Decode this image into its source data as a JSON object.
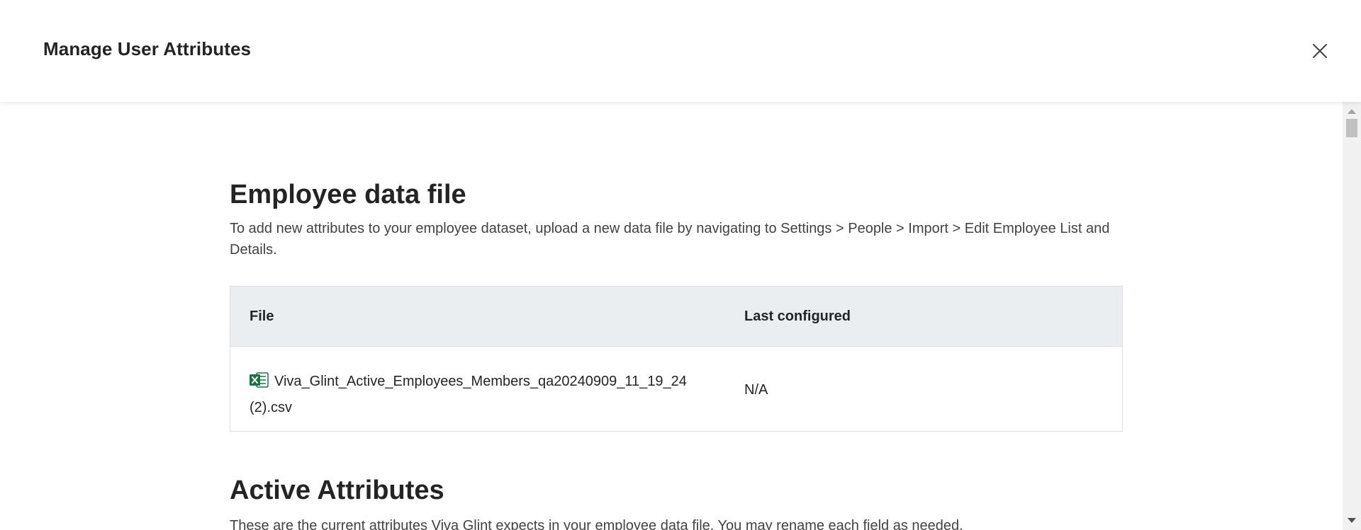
{
  "dialog": {
    "title": "Manage User Attributes",
    "close_icon": "close-icon"
  },
  "employee_data": {
    "heading": "Employee data file",
    "description": "To add new attributes to your employee dataset, upload a new data file by navigating to Settings > People > Import > Edit Employee List and Details.",
    "table": {
      "columns": [
        "File",
        "Last configured"
      ],
      "rows": [
        {
          "file_icon": "excel-file-icon",
          "file_name": "Viva_Glint_Active_Employees_Members_qa20240909_11_19_24 (2).csv",
          "last_configured": "N/A"
        }
      ]
    }
  },
  "active_attributes": {
    "heading": "Active Attributes",
    "description": "These are the current attributes Viva Glint expects in your employee data file. You may rename each field as needed."
  },
  "colors": {
    "table_header_bg": "#ebeef1",
    "excel_green": "#1e7145"
  }
}
